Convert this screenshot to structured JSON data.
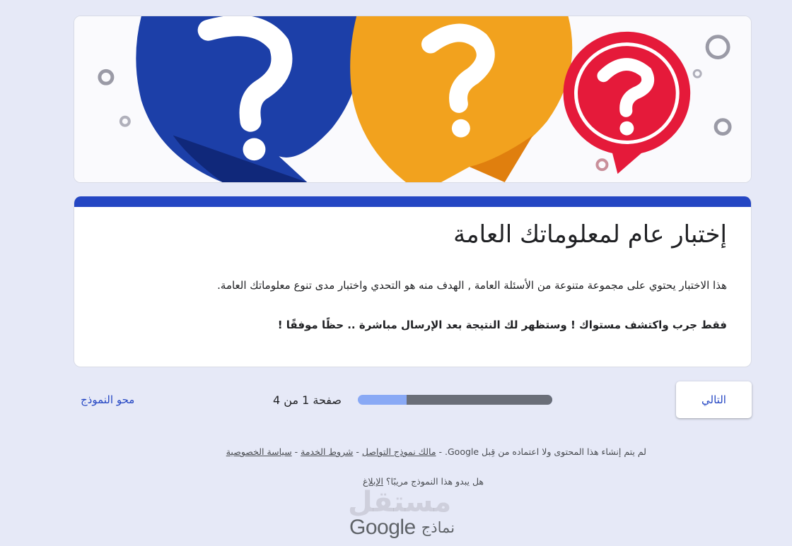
{
  "header_image": {
    "alt": "question-bubbles-banner"
  },
  "form": {
    "title": "إختبار عام لمعلوماتك العامة",
    "description": "هذا الاختبار يحتوي على مجموعة متنوعة من الأسئلة العامة , الهدف منه هو التحدي واختبار مدى تنوع معلوماتك العامة.",
    "bold_note": "فقط جرب واكتشف مستواك ! وستظهر لك النتيجة بعد الإرسال مباشرة .. حظًا موفقًا !"
  },
  "navigation": {
    "next_label": "التالي",
    "page_label": "صفحة 1 من 4",
    "progress": 0.25,
    "clear_label": "محو النموذج"
  },
  "footer": {
    "disclaimer": "لم يتم إنشاء هذا المحتوى ولا اعتماده من قِبل Google. - ",
    "owner_link": "مالك نموذج التواصل",
    "sep1": " - ",
    "terms_link": "شروط الخدمة",
    "sep2": " - ",
    "privacy_link": "سياسة الخصوصية",
    "suspicious": "هل يبدو  هذا النموذج مريبًا؟ ",
    "report_link": "الإبلاغ"
  },
  "brand": {
    "google": "Google",
    "forms": "نماذج",
    "watermark": "مستقل"
  },
  "colors": {
    "accent": "#2446c3",
    "background": "#e6e9f7",
    "progress_light": "#89a9f5",
    "progress_dark": "#6a6e78"
  }
}
